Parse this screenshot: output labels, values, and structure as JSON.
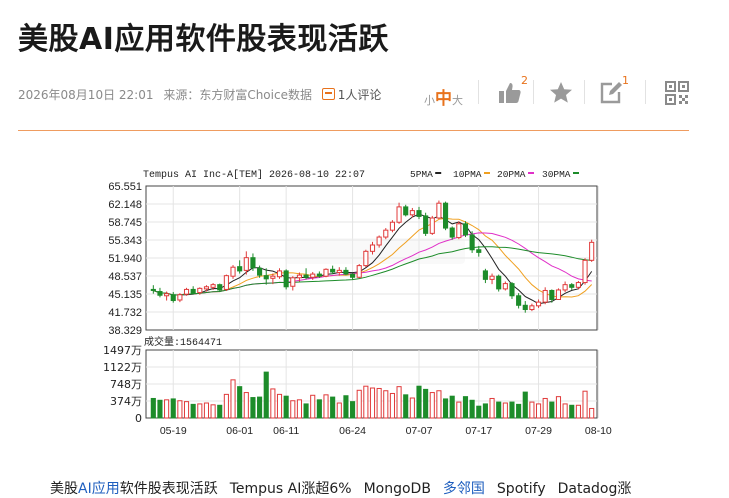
{
  "article": {
    "title": "美股AI应用软件股表现活跃",
    "datetime": "2026年08月10日 22:01",
    "source": "来源：东方财富Choice数据",
    "comments": "1人评论"
  },
  "font_size_control": {
    "small": "小",
    "medium": "中",
    "large": "大"
  },
  "toolbar": {
    "like_count": "2",
    "edit_count": "1"
  },
  "icons": [
    "comment-icon",
    "thumbs-up-icon",
    "star-icon",
    "share-edit-icon",
    "qrcode-icon"
  ],
  "colors": {
    "accent": "#e8721c",
    "up": "#e03a3a",
    "down": "#1d8c2a",
    "link": "#1f5fbf"
  },
  "chart_data": {
    "type": "candlestick",
    "header": "Tempus AI Inc-A[TEM] 2026-08-10 22:07",
    "ma_labels": [
      "5PMA",
      "10PMA",
      "20PMA",
      "30PMA"
    ],
    "ma_colors": [
      "#222222",
      "#f0a020",
      "#e030c8",
      "#1d8c2a"
    ],
    "price_ticks": [
      "65.551",
      "62.148",
      "58.745",
      "55.343",
      "51.940",
      "48.537",
      "45.135",
      "41.732",
      "38.329"
    ],
    "ylim": [
      38.329,
      65.551
    ],
    "volume_label": "成交量",
    "volume_value": "1564471",
    "volume_ticks": [
      "1497万",
      "1122万",
      "748万",
      "374万",
      "0"
    ],
    "volume_ylim": [
      0,
      1497
    ],
    "x_ticks": [
      {
        "index": 3,
        "label": "05-19"
      },
      {
        "index": 13,
        "label": "06-01"
      },
      {
        "index": 20,
        "label": "06-11"
      },
      {
        "index": 30,
        "label": "06-24"
      },
      {
        "index": 40,
        "label": "07-07"
      },
      {
        "index": 49,
        "label": "07-17"
      },
      {
        "index": 58,
        "label": "07-29"
      },
      {
        "index": 67,
        "label": "08-10"
      }
    ],
    "candles": [
      [
        46.0,
        46.8,
        45.2,
        45.8,
        430
      ],
      [
        45.6,
        46.3,
        44.5,
        44.9,
        390
      ],
      [
        44.8,
        45.6,
        43.9,
        45.2,
        400
      ],
      [
        45.0,
        45.5,
        43.5,
        43.9,
        420
      ],
      [
        44.0,
        45.3,
        43.6,
        45.0,
        380
      ],
      [
        45.1,
        46.3,
        44.8,
        46.0,
        360
      ],
      [
        46.0,
        46.6,
        45.1,
        45.3,
        300
      ],
      [
        45.4,
        46.4,
        45.0,
        46.2,
        310
      ],
      [
        46.1,
        46.8,
        45.6,
        46.5,
        330
      ],
      [
        46.4,
        47.2,
        45.9,
        46.9,
        290
      ],
      [
        46.9,
        47.1,
        45.5,
        45.9,
        280
      ],
      [
        46.0,
        48.8,
        45.7,
        48.6,
        520
      ],
      [
        48.5,
        50.6,
        48.0,
        50.2,
        840
      ],
      [
        50.3,
        51.5,
        49.0,
        49.5,
        690
      ],
      [
        49.6,
        53.2,
        48.8,
        52.0,
        560
      ],
      [
        52.0,
        52.8,
        49.5,
        50.1,
        450
      ],
      [
        50.0,
        50.5,
        48.2,
        48.7,
        460
      ],
      [
        48.6,
        50.0,
        46.9,
        48.0,
        1010
      ],
      [
        48.1,
        49.0,
        47.0,
        48.5,
        640
      ],
      [
        48.4,
        50.0,
        48.0,
        49.5,
        520
      ],
      [
        49.5,
        49.8,
        46.0,
        46.5,
        480
      ],
      [
        46.6,
        48.5,
        45.8,
        48.2,
        380
      ],
      [
        48.2,
        49.2,
        47.5,
        48.7,
        400
      ],
      [
        48.7,
        50.0,
        47.9,
        48.3,
        310
      ],
      [
        48.3,
        49.3,
        47.8,
        48.9,
        500
      ],
      [
        48.9,
        49.4,
        48.2,
        48.5,
        400
      ],
      [
        48.5,
        50.0,
        48.3,
        49.8,
        510
      ],
      [
        49.8,
        50.5,
        48.9,
        49.3,
        460
      ],
      [
        49.2,
        50.2,
        48.6,
        49.6,
        330
      ],
      [
        49.6,
        50.2,
        48.7,
        48.9,
        490
      ],
      [
        48.9,
        49.1,
        47.8,
        48.3,
        360
      ],
      [
        48.3,
        50.8,
        48.1,
        50.5,
        610
      ],
      [
        50.5,
        53.5,
        50.2,
        53.2,
        700
      ],
      [
        53.2,
        55.0,
        52.6,
        54.4,
        660
      ],
      [
        54.4,
        56.2,
        53.9,
        55.9,
        650
      ],
      [
        55.9,
        57.6,
        55.5,
        57.2,
        600
      ],
      [
        57.2,
        59.1,
        56.8,
        58.7,
        540
      ],
      [
        58.7,
        62.4,
        58.4,
        61.6,
        690
      ],
      [
        61.6,
        62.0,
        59.8,
        60.1,
        510
      ],
      [
        60.1,
        61.4,
        59.6,
        60.9,
        440
      ],
      [
        60.9,
        61.6,
        59.3,
        59.8,
        700
      ],
      [
        59.9,
        60.5,
        56.1,
        56.6,
        630
      ],
      [
        56.6,
        59.9,
        56.3,
        59.5,
        560
      ],
      [
        59.5,
        62.8,
        59.3,
        62.3,
        600
      ],
      [
        62.3,
        62.6,
        57.2,
        57.6,
        420
      ],
      [
        57.6,
        57.9,
        55.4,
        55.9,
        480
      ],
      [
        55.8,
        58.9,
        55.5,
        58.4,
        350
      ],
      [
        58.4,
        58.9,
        55.9,
        56.3,
        470
      ],
      [
        56.3,
        57.0,
        52.9,
        53.5,
        390
      ],
      [
        53.5,
        54.2,
        52.2,
        53.0,
        260
      ],
      [
        49.5,
        49.9,
        47.2,
        47.9,
        310
      ],
      [
        47.9,
        49.0,
        47.0,
        48.5,
        430
      ],
      [
        48.5,
        48.8,
        45.6,
        46.1,
        350
      ],
      [
        46.1,
        47.5,
        45.8,
        47.1,
        330
      ],
      [
        47.1,
        47.4,
        44.2,
        44.8,
        350
      ],
      [
        44.8,
        45.3,
        42.4,
        43.0,
        300
      ],
      [
        43.0,
        43.8,
        41.6,
        42.2,
        570
      ],
      [
        42.2,
        43.3,
        41.9,
        42.9,
        350
      ],
      [
        42.9,
        44.1,
        42.5,
        43.6,
        310
      ],
      [
        43.6,
        46.4,
        43.2,
        45.8,
        430
      ],
      [
        45.8,
        46.0,
        43.5,
        44.1,
        350
      ],
      [
        44.1,
        46.2,
        44.0,
        45.9,
        470
      ],
      [
        45.9,
        47.5,
        45.5,
        46.9,
        310
      ],
      [
        46.9,
        47.2,
        45.9,
        46.4,
        280
      ],
      [
        46.4,
        47.6,
        46.0,
        47.3,
        280
      ],
      [
        47.3,
        51.9,
        46.9,
        51.5,
        590
      ],
      [
        51.5,
        55.4,
        51.2,
        54.9,
        210
      ]
    ]
  },
  "related": {
    "items": [
      {
        "text": "美股",
        "type": "text"
      },
      {
        "text": "AI应用",
        "type": "link"
      },
      {
        "text": "软件股表现活跃",
        "type": "text"
      },
      {
        "text": "Tempus AI涨超6%",
        "type": "text"
      },
      {
        "text": "MongoDB",
        "type": "text"
      },
      {
        "text": "多邻国",
        "type": "link"
      },
      {
        "text": "Spotify",
        "type": "text"
      },
      {
        "text": "Datadog涨",
        "type": "text"
      }
    ]
  }
}
